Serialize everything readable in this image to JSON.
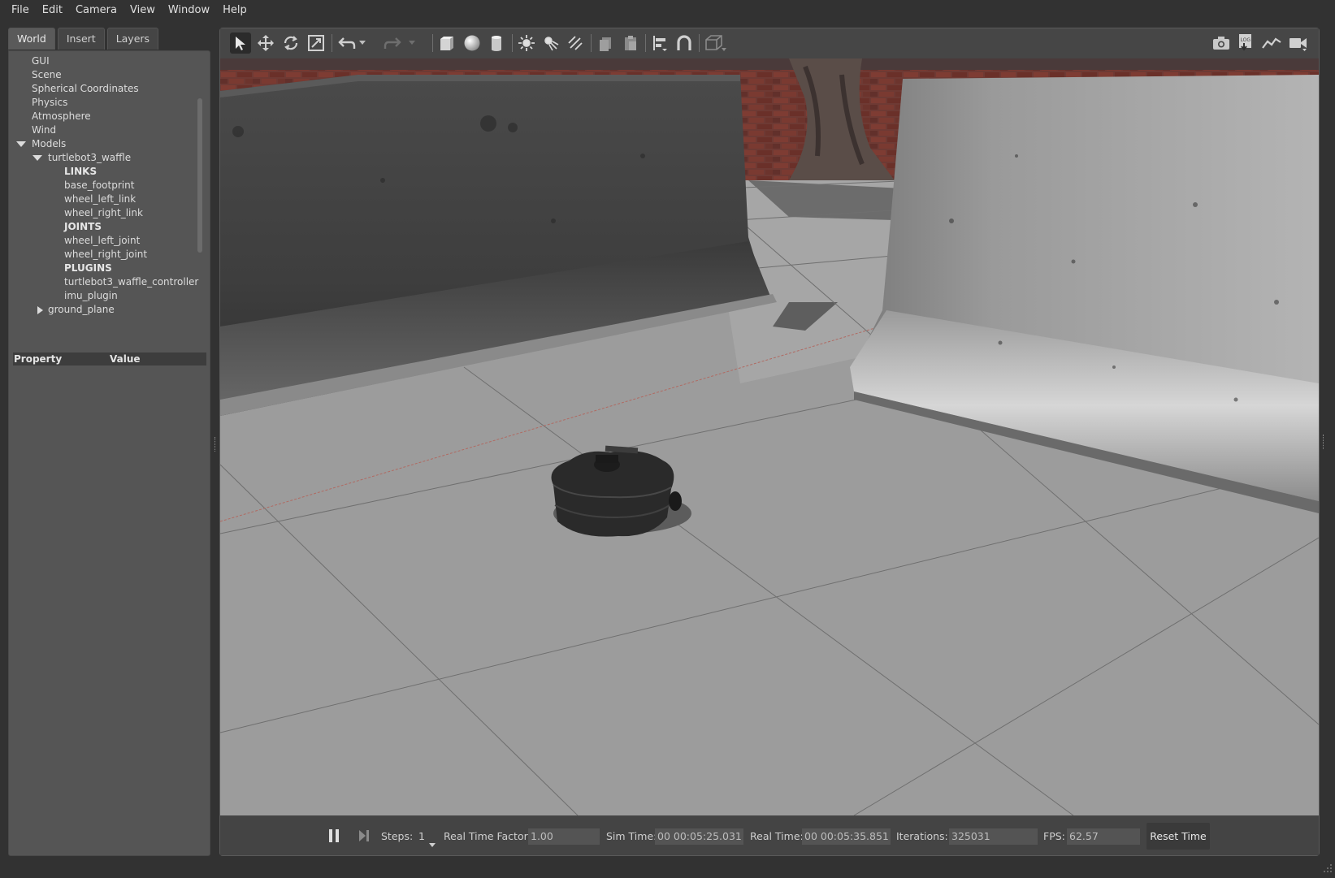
{
  "menubar": {
    "items": [
      "File",
      "Edit",
      "Camera",
      "View",
      "Window",
      "Help"
    ]
  },
  "left_panel": {
    "tabs": [
      "World",
      "Insert",
      "Layers"
    ],
    "active_tab": "World",
    "tree": {
      "gui": "GUI",
      "scene": "Scene",
      "spherical": "Spherical Coordinates",
      "physics": "Physics",
      "atmosphere": "Atmosphere",
      "wind": "Wind",
      "models": "Models",
      "model_name": "turtlebot3_waffle",
      "links_header": "LINKS",
      "links": [
        "base_footprint",
        "wheel_left_link",
        "wheel_right_link"
      ],
      "joints_header": "JOINTS",
      "joints": [
        "wheel_left_joint",
        "wheel_right_joint"
      ],
      "plugins_header": "PLUGINS",
      "plugins": [
        "turtlebot3_waffle_controller",
        "imu_plugin"
      ],
      "ground": "ground_plane"
    },
    "property_header": {
      "property": "Property",
      "value": "Value"
    }
  },
  "toolbar": {
    "left_icons": [
      "select-arrow-icon",
      "translate-icon",
      "rotate-icon",
      "scale-icon",
      "undo-icon",
      "redo-icon",
      "box-icon",
      "sphere-icon",
      "cylinder-icon",
      "point-light-icon",
      "spot-light-icon",
      "directional-light-icon",
      "copy-icon",
      "paste-icon",
      "align-icon",
      "snap-icon",
      "view-angle-icon"
    ],
    "right_icons": [
      "screenshot-icon",
      "log-icon",
      "plot-icon",
      "video-record-icon"
    ]
  },
  "status": {
    "steps_label": "Steps:",
    "steps_value": "1",
    "rtf_label": "Real Time Factor:",
    "rtf_value": "1.00",
    "sim_time_label": "Sim Time:",
    "sim_time_value": "00 00:05:25.031",
    "real_time_label": "Real Time:",
    "real_time_value": "00 00:05:35.851",
    "iterations_label": "Iterations:",
    "iterations_value": "325031",
    "fps_label": "FPS:",
    "fps_value": "62.57",
    "reset_label": "Reset Time"
  },
  "colors": {
    "background": "#323232",
    "panel": "#555555",
    "viewport_floor": "#9a9a9a",
    "brick": "#7a3a32"
  }
}
